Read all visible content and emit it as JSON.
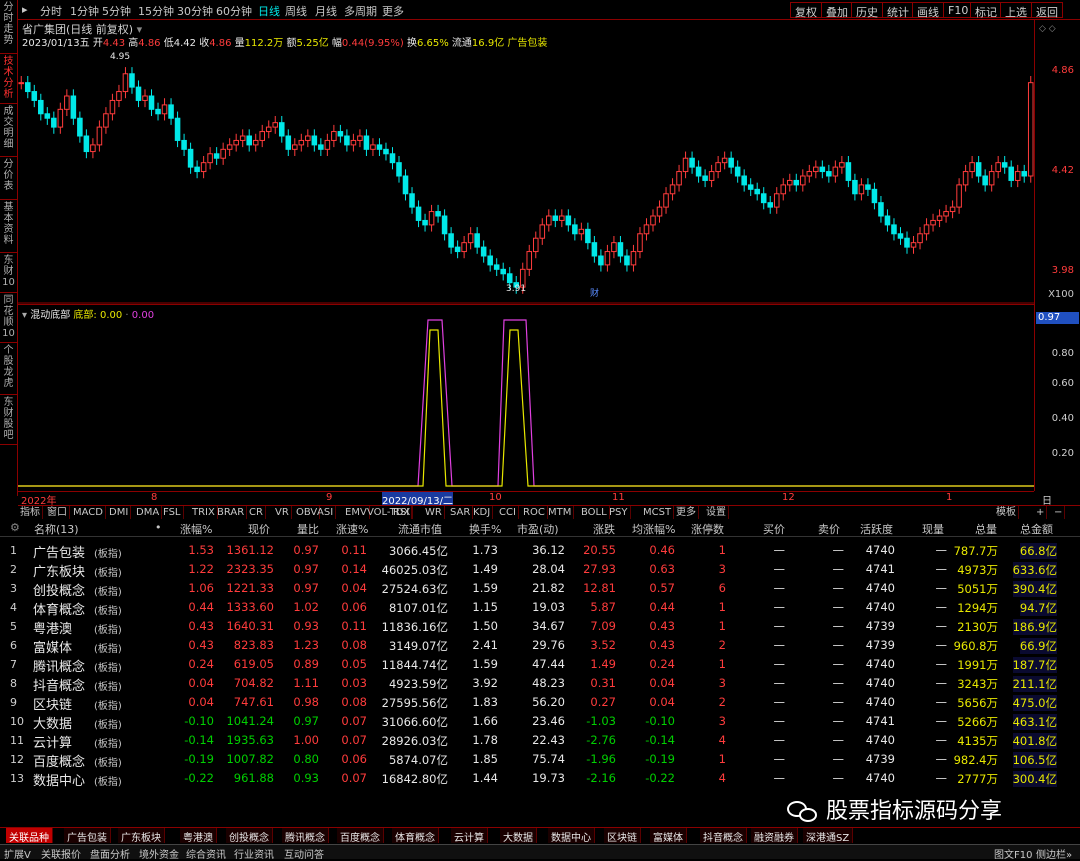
{
  "left_tabs": [
    "分时走势",
    "技术分析",
    "成交明细",
    "分价表",
    "基本资料",
    "东财10",
    "同花顺10",
    "个股龙虎",
    "东财股吧"
  ],
  "periods": [
    "分时",
    "1分钟",
    "5分钟",
    "15分钟",
    "30分钟",
    "60分钟",
    "日线",
    "周线",
    "月线",
    "多周期",
    "更多"
  ],
  "right_buttons": [
    "复权",
    "叠加",
    "历史",
    "统计",
    "画线",
    "F10",
    "标记",
    "上选",
    "返回"
  ],
  "title": "省广集团(日线 前复权)",
  "info1": {
    "date": "2023/01/13五",
    "open_l": "开",
    "open": "4.43",
    "high_l": "高",
    "high": "4.86",
    "low_l": "低",
    "low": "4.42",
    "close_l": "收",
    "close": "4.86",
    "vol_l": "量",
    "vol": "112.2万",
    "amt_l": "额",
    "amt": "5.25亿",
    "chg_l": "幅",
    "chg": "0.44(9.95%)",
    "turn_l": "换",
    "turn": "6.65%",
    "float_l": "流通",
    "float": "16.9亿",
    "concept": "广告包装"
  },
  "price_axis": [
    "4.86",
    "4.42",
    "3.98",
    "X100"
  ],
  "annotations": {
    "high": "4.95",
    "low": "3.91",
    "cai": "财"
  },
  "indicator": {
    "name": "混动底部",
    "label": "底部:",
    "v1": "0.00",
    "v2": "0.00"
  },
  "ind_axis": [
    "0.97",
    "0.80",
    "0.60",
    "0.40",
    "0.20"
  ],
  "dates": [
    "2022年",
    "8",
    "9",
    "2022/09/13/二",
    "10",
    "11",
    "12",
    "1",
    "日线"
  ],
  "ind_tabs": [
    "指标",
    "窗口",
    "MACD",
    "DMI",
    "DMA",
    "FSL",
    "TRIX",
    "BRAR",
    "CR",
    "VR",
    "OBV",
    "ASI",
    "EMV",
    "VOL-TDX",
    "RSI",
    "WR",
    "SAR",
    "KDJ",
    "CCI",
    "ROC",
    "MTM",
    "BOLL",
    "PSY",
    "MCST",
    "更多",
    "设置"
  ],
  "ind_tabs_right": [
    "模板",
    "+",
    "−"
  ],
  "headers": [
    "名称(13)",
    "•",
    "涨幅%",
    "现价",
    "量比",
    "涨速%",
    "流通市值",
    "换手%",
    "市盈(动)",
    "涨跌",
    "均涨幅%",
    "涨停数",
    "买价",
    "卖价",
    "活跃度",
    "现量",
    "总量",
    "总金额"
  ],
  "rows": [
    {
      "n": "1",
      "name": "广告包装",
      "tag": "(板指)",
      "chg": "1.53",
      "price": "1361.12",
      "lb": "0.97",
      "spd": "0.11",
      "mv": "3066.45亿",
      "turn": "1.73",
      "pe": "36.12",
      "zd": "20.55",
      "avg": "0.46",
      "zt": "1",
      "buy": "—",
      "sell": "—",
      "act": "4740",
      "xl": "—",
      "vol": "787.7万",
      "amt": "66.8亿"
    },
    {
      "n": "2",
      "name": "广东板块",
      "tag": "(板指)",
      "chg": "1.22",
      "price": "2323.35",
      "lb": "0.97",
      "spd": "0.14",
      "mv": "46025.03亿",
      "turn": "1.49",
      "pe": "28.04",
      "zd": "27.93",
      "avg": "0.63",
      "zt": "3",
      "buy": "—",
      "sell": "—",
      "act": "4741",
      "xl": "—",
      "vol": "4973万",
      "amt": "633.6亿"
    },
    {
      "n": "3",
      "name": "创投概念",
      "tag": "(板指)",
      "chg": "1.06",
      "price": "1221.33",
      "lb": "0.97",
      "spd": "0.04",
      "mv": "27524.63亿",
      "turn": "1.59",
      "pe": "21.82",
      "zd": "12.81",
      "avg": "0.57",
      "zt": "6",
      "buy": "—",
      "sell": "—",
      "act": "4740",
      "xl": "—",
      "vol": "5051万",
      "amt": "390.4亿"
    },
    {
      "n": "4",
      "name": "体育概念",
      "tag": "(板指)",
      "chg": "0.44",
      "price": "1333.60",
      "lb": "1.02",
      "spd": "0.06",
      "mv": "8107.01亿",
      "turn": "1.15",
      "pe": "19.03",
      "zd": "5.87",
      "avg": "0.44",
      "zt": "1",
      "buy": "—",
      "sell": "—",
      "act": "4740",
      "xl": "—",
      "vol": "1294万",
      "amt": "94.7亿"
    },
    {
      "n": "5",
      "name": "粤港澳",
      "tag": "(板指)",
      "chg": "0.43",
      "price": "1640.31",
      "lb": "0.93",
      "spd": "0.11",
      "mv": "11836.16亿",
      "turn": "1.50",
      "pe": "34.67",
      "zd": "7.09",
      "avg": "0.43",
      "zt": "1",
      "buy": "—",
      "sell": "—",
      "act": "4739",
      "xl": "—",
      "vol": "2130万",
      "amt": "186.9亿"
    },
    {
      "n": "6",
      "name": "富媒体",
      "tag": "(板指)",
      "chg": "0.43",
      "price": "823.83",
      "lb": "1.23",
      "spd": "0.08",
      "mv": "3149.07亿",
      "turn": "2.41",
      "pe": "29.76",
      "zd": "3.52",
      "avg": "0.43",
      "zt": "2",
      "buy": "—",
      "sell": "—",
      "act": "4739",
      "xl": "—",
      "vol": "960.8万",
      "amt": "66.9亿"
    },
    {
      "n": "7",
      "name": "腾讯概念",
      "tag": "(板指)",
      "chg": "0.24",
      "price": "619.05",
      "lb": "0.89",
      "spd": "0.05",
      "mv": "11844.74亿",
      "turn": "1.59",
      "pe": "47.44",
      "zd": "1.49",
      "avg": "0.24",
      "zt": "1",
      "buy": "—",
      "sell": "—",
      "act": "4740",
      "xl": "—",
      "vol": "1991万",
      "amt": "187.7亿"
    },
    {
      "n": "8",
      "name": "抖音概念",
      "tag": "(板指)",
      "chg": "0.04",
      "price": "704.82",
      "lb": "1.11",
      "spd": "0.03",
      "mv": "4923.59亿",
      "turn": "3.92",
      "pe": "48.23",
      "zd": "0.31",
      "avg": "0.04",
      "zt": "3",
      "buy": "—",
      "sell": "—",
      "act": "4740",
      "xl": "—",
      "vol": "3243万",
      "amt": "211.1亿"
    },
    {
      "n": "9",
      "name": "区块链",
      "tag": "(板指)",
      "chg": "0.04",
      "price": "747.61",
      "lb": "0.98",
      "spd": "0.08",
      "mv": "27595.56亿",
      "turn": "1.83",
      "pe": "56.20",
      "zd": "0.27",
      "avg": "0.04",
      "zt": "2",
      "buy": "—",
      "sell": "—",
      "act": "4740",
      "xl": "—",
      "vol": "5656万",
      "amt": "475.0亿"
    },
    {
      "n": "10",
      "name": "大数据",
      "tag": "(板指)",
      "chg": "-0.10",
      "price": "1041.24",
      "lb": "0.97",
      "spd": "0.07",
      "mv": "31066.60亿",
      "turn": "1.66",
      "pe": "23.46",
      "zd": "-1.03",
      "avg": "-0.10",
      "zt": "3",
      "buy": "—",
      "sell": "—",
      "act": "4741",
      "xl": "—",
      "vol": "5266万",
      "amt": "463.1亿"
    },
    {
      "n": "11",
      "name": "云计算",
      "tag": "(板指)",
      "chg": "-0.14",
      "price": "1935.63",
      "lb": "1.00",
      "spd": "0.07",
      "mv": "28926.03亿",
      "turn": "1.78",
      "pe": "22.43",
      "zd": "-2.76",
      "avg": "-0.14",
      "zt": "4",
      "buy": "—",
      "sell": "—",
      "act": "4740",
      "xl": "—",
      "vol": "4135万",
      "amt": "401.8亿"
    },
    {
      "n": "12",
      "name": "百度概念",
      "tag": "(板指)",
      "chg": "-0.19",
      "price": "1007.82",
      "lb": "0.80",
      "spd": "0.06",
      "mv": "5874.07亿",
      "turn": "1.85",
      "pe": "75.74",
      "zd": "-1.96",
      "avg": "-0.19",
      "zt": "1",
      "buy": "—",
      "sell": "—",
      "act": "4739",
      "xl": "—",
      "vol": "982.4万",
      "amt": "106.5亿"
    },
    {
      "n": "13",
      "name": "数据中心",
      "tag": "(板指)",
      "chg": "-0.22",
      "price": "961.88",
      "lb": "0.93",
      "spd": "0.07",
      "mv": "16842.80亿",
      "turn": "1.44",
      "pe": "19.73",
      "zd": "-2.16",
      "avg": "-0.22",
      "zt": "4",
      "buy": "—",
      "sell": "—",
      "act": "4740",
      "xl": "—",
      "vol": "2777万",
      "amt": "300.4亿"
    }
  ],
  "bottom_tabs": [
    "关联品种",
    "广告包装",
    "广东板块",
    "粤港澳",
    "创投概念",
    "腾讯概念",
    "百度概念",
    "体育概念",
    "云计算",
    "大数据",
    "数据中心",
    "区块链",
    "富媒体",
    "抖音概念",
    "融资融券",
    "深港通SZ"
  ],
  "status": [
    "扩展V",
    "关联报价",
    "盘面分析",
    "境外资金",
    "综合资讯",
    "行业资讯",
    "互动问答"
  ],
  "status_right": [
    "图文F10",
    "侧边栏»"
  ],
  "watermark": "股票指标源码分享",
  "colors": {
    "up": "#ff3c3c",
    "down": "#00d000",
    "kdown": "#00e8e8",
    "border": "#8b0000",
    "indicator": "#e040e0",
    "indicator2": "#e8e800"
  }
}
